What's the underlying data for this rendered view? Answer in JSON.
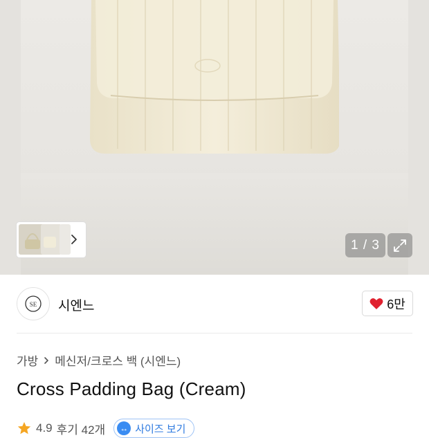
{
  "gallery": {
    "counter": "1 / 3",
    "thumb_next_icon": "chevron-right-icon",
    "expand_icon": "expand-icon",
    "bag_color": "#f1ebd6"
  },
  "brand": {
    "logo_text": "SE",
    "name": "시엔느",
    "like_count": "6만",
    "like_color": "#e0212f"
  },
  "breadcrumb": {
    "category": "가방",
    "separator_icon": "chevron-right-icon",
    "subcategory": "메신저/크로스 백 (시엔느)"
  },
  "product": {
    "title": "Cross Padding Bag (Cream)",
    "rating": "4.9",
    "reviews": "후기 42개",
    "size_tag": "사이즈 보기",
    "rating_star_color": "#f5a623"
  }
}
